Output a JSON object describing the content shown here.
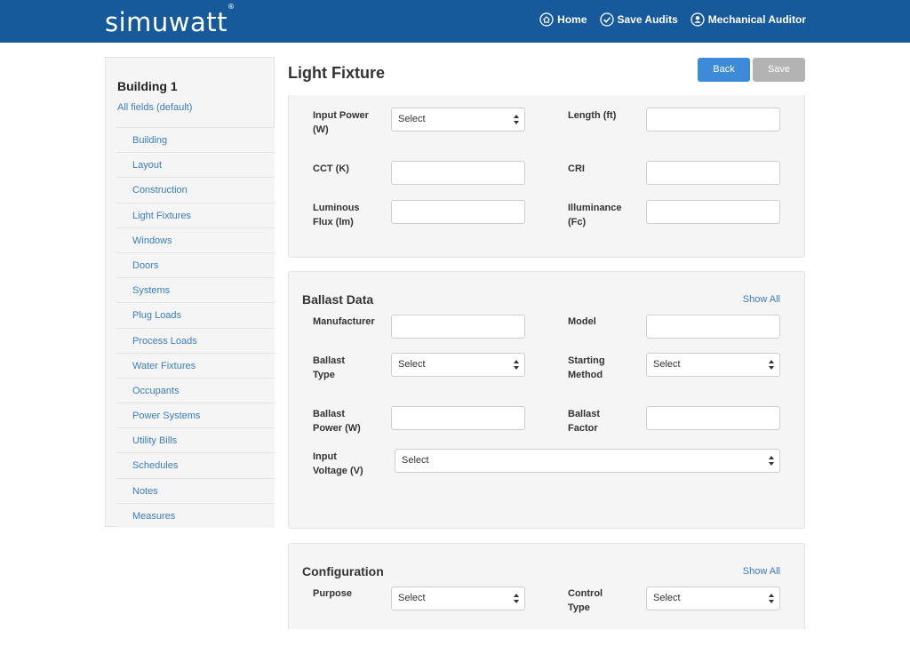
{
  "header": {
    "logo": "simuwatt",
    "logo_mark": "®",
    "nav": [
      {
        "label": "Home",
        "icon": "home-icon"
      },
      {
        "label": "Save Audits",
        "icon": "check-circle-icon"
      },
      {
        "label": "Mechanical Auditor",
        "icon": "user-icon"
      }
    ]
  },
  "sidebar": {
    "title": "Building 1",
    "filter": "All fields (default)",
    "items": [
      "Building",
      "Layout",
      "Construction",
      "Light Fixtures",
      "Windows",
      "Doors",
      "Systems",
      "Plug Loads",
      "Process Loads",
      "Water Fixtures",
      "Occupants",
      "Power Systems",
      "Utility Bills",
      "Schedules",
      "Notes",
      "Measures"
    ]
  },
  "main": {
    "title": "Light Fixture",
    "back_label": "Back",
    "save_label": "Save",
    "select_placeholder": "Select",
    "show_all": "Show All",
    "fixture": {
      "input_power": "Input Power (W)",
      "length": "Length (ft)",
      "cct": "CCT (K)",
      "cri": "CRI",
      "luminous_flux": "Luminous Flux (lm)",
      "illuminance": "Illuminance (Fc)"
    },
    "ballast": {
      "title": "Ballast Data",
      "manufacturer": "Manufacturer",
      "model": "Model",
      "ballast_type": "Ballast Type",
      "starting_method": "Starting Method",
      "ballast_power": "Ballast Power (W)",
      "ballast_factor": "Ballast Factor",
      "input_voltage": "Input Voltage (V)"
    },
    "configuration": {
      "title": "Configuration",
      "purpose": "Purpose",
      "control_type": "Control Type"
    }
  },
  "colors": {
    "header_bg": "#165a9c",
    "link": "#3a7cc3",
    "primary_button": "#3c8ad8",
    "disabled_button": "#b3b3b3"
  }
}
